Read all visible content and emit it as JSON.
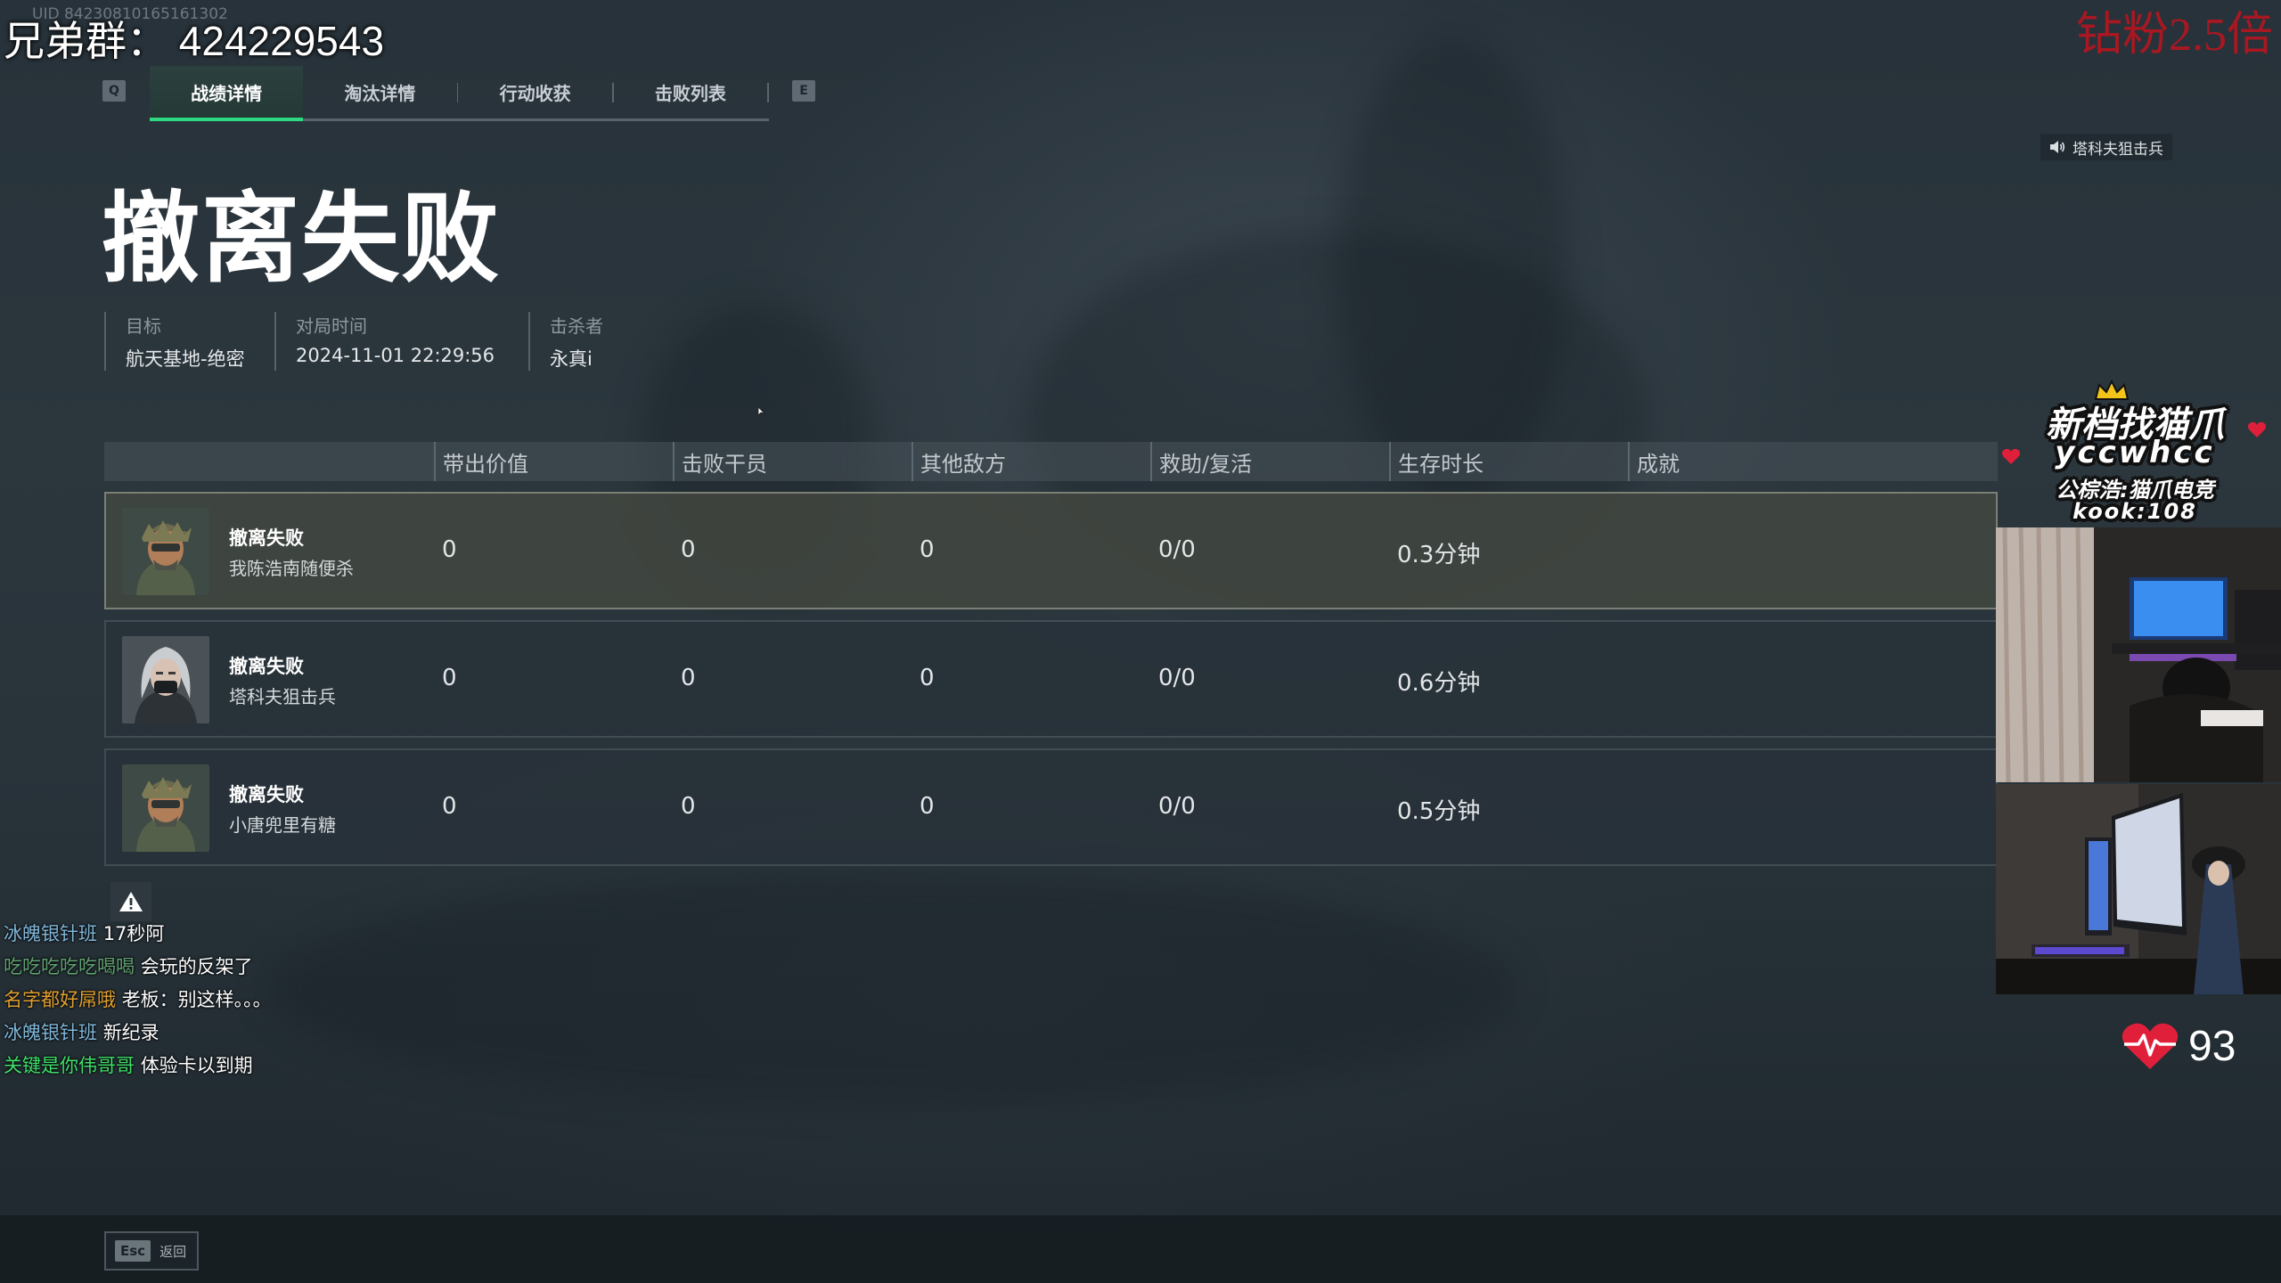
{
  "overlay": {
    "group_text": "兄弟群：  424229543",
    "uid_text": "UID 84230810165161302",
    "promo_top": "钻粉2.5倍"
  },
  "tabs": {
    "left_key": "Q",
    "right_key": "E",
    "items": [
      {
        "label": "战绩详情",
        "active": true
      },
      {
        "label": "淘汰详情",
        "active": false
      },
      {
        "label": "行动收获",
        "active": false
      },
      {
        "label": "击败列表",
        "active": false
      }
    ]
  },
  "title": "撤离失败",
  "info": {
    "target": {
      "label": "目标",
      "value": "航天基地-绝密"
    },
    "time": {
      "label": "对局时间",
      "value": "2024-11-01 22:29:56"
    },
    "killer": {
      "label": "击杀者",
      "value": "永真i"
    }
  },
  "voice_tag": "塔科夫狙击兵",
  "table": {
    "headers": [
      "带出价值",
      "击败干员",
      "其他敌方",
      "救助/复活",
      "生存时长",
      "成就"
    ],
    "rows": [
      {
        "status": "撤离失败",
        "name": "我陈浩南随便杀",
        "value": "0",
        "kills": "0",
        "others": "0",
        "revive": "0/0",
        "survival": "0.3分钟",
        "achievement": ""
      },
      {
        "status": "撤离失败",
        "name": "塔科夫狙击兵",
        "value": "0",
        "kills": "0",
        "others": "0",
        "revive": "0/0",
        "survival": "0.6分钟",
        "achievement": ""
      },
      {
        "status": "撤离失败",
        "name": "小唐兜里有糖",
        "value": "0",
        "kills": "0",
        "others": "0",
        "revive": "0/0",
        "survival": "0.5分钟",
        "achievement": ""
      }
    ]
  },
  "chat": [
    {
      "user": "冰魄银针班",
      "user_color": "#7fb6d9",
      "msg": "17秒阿"
    },
    {
      "user": "吃吃吃吃吃喝喝",
      "user_color": "#5fa070",
      "msg": "会玩的反架了"
    },
    {
      "user": "名字都好屌哦",
      "user_color": "#e0a030",
      "msg": "老板：别这样。。。"
    },
    {
      "user": "冰魄银针班",
      "user_color": "#7fb6d9",
      "msg": "新纪录"
    },
    {
      "user": "关键是你伟哥哥",
      "user_color": "#3ee06a",
      "msg": "体验卡以到期"
    }
  ],
  "bottom": {
    "esc_key": "Esc",
    "esc_label": "返回"
  },
  "logo": {
    "line1": "新档找猫爪",
    "line2": "yccwhcc",
    "line3": "公棕浩:猫爪电竞",
    "line4": "kook:108"
  },
  "heart_rate": "93",
  "colors": {
    "accent_green": "#2fd883",
    "promo_red": "#be141e",
    "heart_red": "#e0203a"
  }
}
